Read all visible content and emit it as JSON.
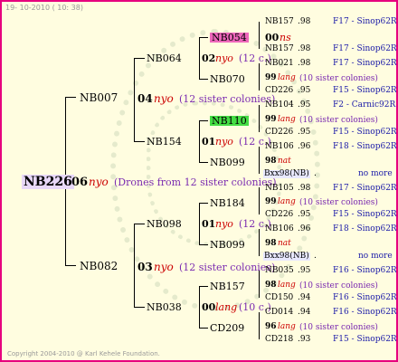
{
  "date": "19- 10-2010 ( 10: 38)",
  "copyright": "Copyright 2004-2010 @ Karl Kehele Foundation.",
  "root": {
    "id": "NB226",
    "gen": "06",
    "race": "nyo",
    "note": "(Drones from 12 sister colonies)"
  },
  "g1": [
    {
      "id": "NB007",
      "gen": "04",
      "race": "nyo",
      "note": "(12 sister colonies)"
    },
    {
      "id": "NB082",
      "gen": "03",
      "race": "nyo",
      "note": "(12 sister colonies)"
    }
  ],
  "g2": [
    {
      "id": "NB064",
      "gen": "02",
      "race": "nyo",
      "note": "(12 c.)"
    },
    {
      "id": "NB154",
      "gen": "01",
      "race": "nyo",
      "note": "(12 c.)"
    },
    {
      "id": "NB098",
      "gen": "01",
      "race": "nyo",
      "note": "(12 c.)"
    },
    {
      "id": "NB038",
      "gen": "00",
      "race": "lang",
      "note": "(10 c.)"
    }
  ],
  "g3": [
    {
      "id": "NB054",
      "gen": "00",
      "race": "ns"
    },
    {
      "id": "NB070",
      "gen": "99",
      "race": "lang",
      "note": "(10 sister colonies)"
    },
    {
      "id": "NB110",
      "gen": "99",
      "race": "lang",
      "note": "(10 sister colonies)"
    },
    {
      "id": "NB099",
      "gen": "98",
      "race": "nat"
    },
    {
      "id": "NB184",
      "gen": "99",
      "race": "lang",
      "note": "(10 sister colonies)"
    },
    {
      "id": "NB099",
      "gen": "98",
      "race": "nat"
    },
    {
      "id": "NB157",
      "gen": "98",
      "race": "lang",
      "note": "(10 sister colonies)"
    },
    {
      "id": "CD209",
      "gen": "96",
      "race": "lang",
      "note": "(10 sister colonies)"
    }
  ],
  "g4": [
    {
      "id": "NB157",
      "year": ".98",
      "ref": "F17 - Sinop62R"
    },
    {
      "id": "NB157",
      "year": ".98",
      "ref": "F17 - Sinop62R"
    },
    {
      "id": "NB021",
      "year": ".98",
      "ref": "F17 - Sinop62R"
    },
    {
      "id": "CD226",
      "year": ".95",
      "ref": "F15 - Sinop62R"
    },
    {
      "id": "NB104",
      "year": ".95",
      "ref": "F2 - Carnic92R"
    },
    {
      "id": "CD226",
      "year": ".95",
      "ref": "F15 - Sinop62R"
    },
    {
      "id": "NB106",
      "year": ".96",
      "ref": "F18 - Sinop62R"
    },
    {
      "id": "Bxx98(NB)",
      "year": ".",
      "ref": "no more"
    },
    {
      "id": "NB105",
      "year": ".98",
      "ref": "F17 - Sinop62R"
    },
    {
      "id": "CD226",
      "year": ".95",
      "ref": "F15 - Sinop62R"
    },
    {
      "id": "NB106",
      "year": ".96",
      "ref": "F18 - Sinop62R"
    },
    {
      "id": "Bxx98(NB)",
      "year": ".",
      "ref": "no more"
    },
    {
      "id": "NB035",
      "year": ".95",
      "ref": "F16 - Sinop62R"
    },
    {
      "id": "CD150",
      "year": ".94",
      "ref": "F16 - Sinop62R"
    },
    {
      "id": "CD014",
      "year": ".94",
      "ref": "F16 - Sinop62R"
    },
    {
      "id": "CD218",
      "year": ".93",
      "ref": "F15 - Sinop62R"
    }
  ],
  "colors": {
    "frame": "#e6007e",
    "bg": "#fffde0",
    "root_bg": "#e8d8f8",
    "hl_pink": "#ee66bb",
    "hl_green": "#44dd44"
  }
}
